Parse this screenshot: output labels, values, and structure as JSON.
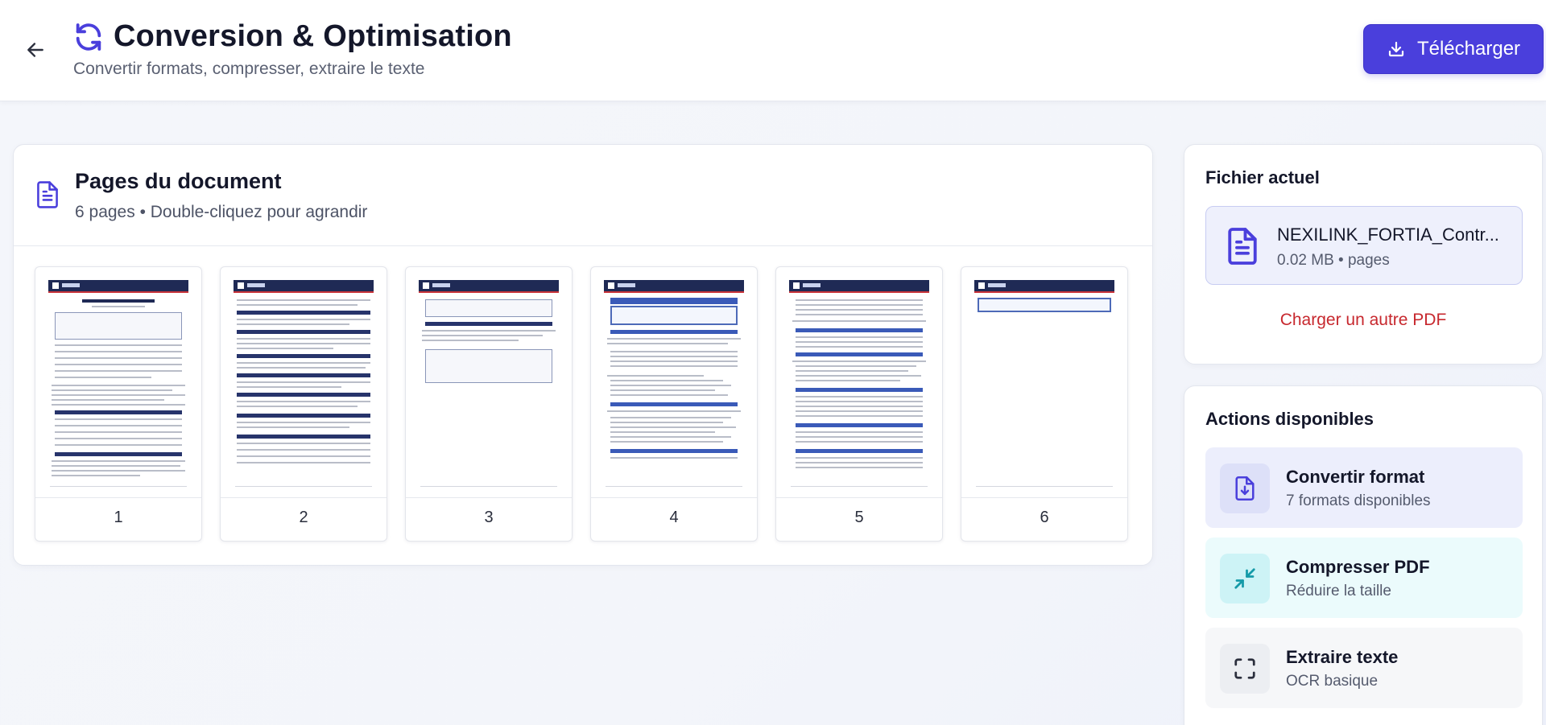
{
  "header": {
    "title": "Conversion & Optimisation",
    "subtitle": "Convertir formats, compresser, extraire le texte",
    "download_label": "Télécharger"
  },
  "pages_panel": {
    "title": "Pages du document",
    "subtitle": "6 pages • Double-cliquez pour agrandir",
    "pages": [
      {
        "number": "1"
      },
      {
        "number": "2"
      },
      {
        "number": "3"
      },
      {
        "number": "4"
      },
      {
        "number": "5"
      },
      {
        "number": "6"
      }
    ]
  },
  "current_file": {
    "title": "Fichier actuel",
    "file_name": "NEXILINK_FORTIA_Contr...",
    "file_meta": "0.02 MB • pages",
    "reload_label": "Charger un autre PDF"
  },
  "actions": {
    "title": "Actions disponibles",
    "items": [
      {
        "title": "Convertir format",
        "subtitle": "7 formats disponibles",
        "icon": "file-download-icon"
      },
      {
        "title": "Compresser PDF",
        "subtitle": "Réduire la taille",
        "icon": "compress-icon"
      },
      {
        "title": "Extraire texte",
        "subtitle": "OCR basique",
        "icon": "scan-icon"
      }
    ]
  },
  "colors": {
    "accent": "#4a3fdc",
    "link_red": "#c7282e",
    "convert_bg": "#eceefc",
    "compress_bg": "#ebfbfc",
    "extract_bg": "#f6f7f9"
  }
}
